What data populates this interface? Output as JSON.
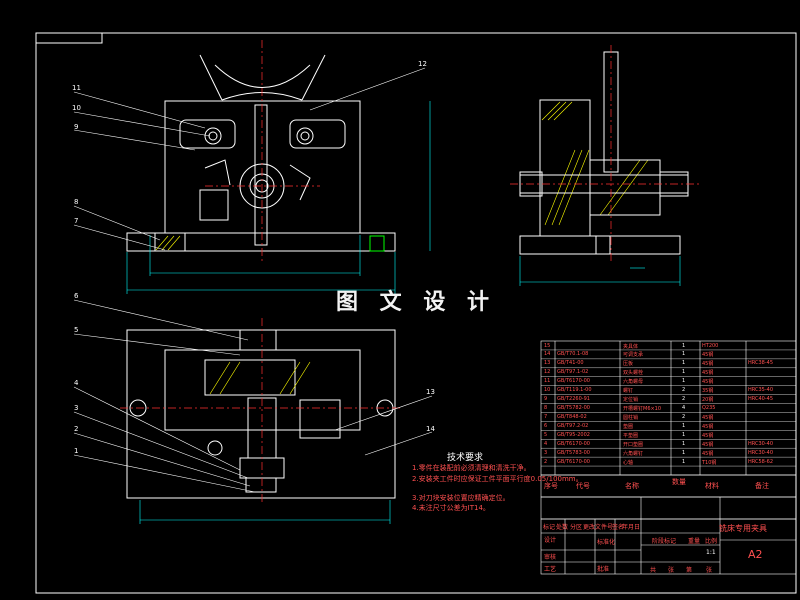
{
  "drawing": {
    "watermark": "图 文 设 计",
    "title": "铣床专用夹具",
    "sheet_size": "A2",
    "colors": {
      "background": "#000000",
      "outline": "#ffffff",
      "dimension": "#00ffff",
      "centerline": "#ff3030",
      "hatch": "#ffff00",
      "part": "#00ff00",
      "text": "#ff5050"
    }
  },
  "technical_requirements": {
    "title": "技术要求",
    "items": [
      "1.零件在装配前必须清理和清洗干净。",
      "2.安装夹工件时应保证工件平面平行度0.05/100mm。",
      "3.对刀块安装位置应精确定位。",
      "4.未注尺寸公差为IT14。"
    ]
  },
  "balloons_front": [
    "11",
    "10",
    "9",
    "8",
    "7",
    "12"
  ],
  "balloons_top": [
    "6",
    "5",
    "4",
    "3",
    "2",
    "1",
    "13",
    "14"
  ],
  "bom": {
    "rows": [
      {
        "no": "15",
        "code": "",
        "name": "夹具体",
        "qty": "1",
        "material": "HT200",
        "note": ""
      },
      {
        "no": "14",
        "code": "GB/T70.1-08",
        "name": "可调支承",
        "qty": "1",
        "material": "45钢",
        "note": ""
      },
      {
        "no": "13",
        "code": "GB/T41-00",
        "name": "压板",
        "qty": "1",
        "material": "45钢",
        "note": "HRC38-45"
      },
      {
        "no": "12",
        "code": "GB/T97.1-02",
        "name": "双头螺栓",
        "qty": "1",
        "material": "45钢",
        "note": ""
      },
      {
        "no": "11",
        "code": "GB/T6170-00",
        "name": "六角螺母",
        "qty": "1",
        "material": "45钢",
        "note": ""
      },
      {
        "no": "10",
        "code": "GB/T119.1-00",
        "name": "螺钉",
        "qty": "2",
        "material": "35钢",
        "note": "HRC35-40"
      },
      {
        "no": "9",
        "code": "GB/T2260-91",
        "name": "定位销",
        "qty": "2",
        "material": "20钢",
        "note": "HRC40-45"
      },
      {
        "no": "8",
        "code": "GB/T5782-00",
        "name": "开槽螺钉M6×10",
        "qty": "4",
        "material": "Q235",
        "note": ""
      },
      {
        "no": "7",
        "code": "GB/T848-02",
        "name": "圆柱销",
        "qty": "2",
        "material": "45钢",
        "note": ""
      },
      {
        "no": "6",
        "code": "GB/T97.2-02",
        "name": "垫圈",
        "qty": "1",
        "material": "45钢",
        "note": ""
      },
      {
        "no": "5",
        "code": "GB/T95-2002",
        "name": "平垫圈",
        "qty": "1",
        "material": "45钢",
        "note": ""
      },
      {
        "no": "4",
        "code": "GB/T6170-00",
        "name": "开口垫圈",
        "qty": "1",
        "material": "45钢",
        "note": "HRC30-40"
      },
      {
        "no": "3",
        "code": "GB/T5783-00",
        "name": "六角螺钉",
        "qty": "1",
        "material": "45钢",
        "note": "HRC30-40"
      },
      {
        "no": "2",
        "code": "GB/T6170-00",
        "name": "心轴",
        "qty": "1",
        "material": "T10钢",
        "note": "HRC58-62"
      }
    ],
    "header": {
      "no": "序号",
      "code": "代号",
      "name": "名称",
      "qty": "数量",
      "material": "材料",
      "note": "备注"
    }
  },
  "title_block": {
    "left_labels": [
      "标记",
      "处数",
      "分区",
      "更改文件号",
      "签名",
      "年月日"
    ],
    "rows": [
      "设计",
      "审核",
      "工艺"
    ],
    "mid_labels": [
      "标准化",
      "批准"
    ],
    "stage_labels": [
      "阶段标记",
      "重量",
      "比例"
    ],
    "scale": "1:1",
    "sheets": [
      "共",
      "张",
      "第",
      "张"
    ]
  }
}
